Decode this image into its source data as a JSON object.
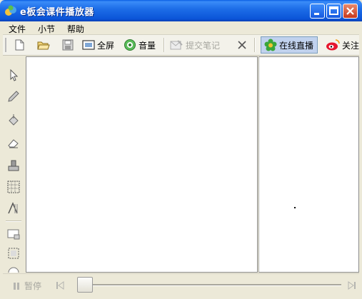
{
  "window": {
    "title": "e板会课件播放器",
    "controls": [
      "minimize",
      "maximize",
      "close"
    ]
  },
  "menu": {
    "items": [
      {
        "label": "文件"
      },
      {
        "label": "小节"
      },
      {
        "label": "帮助"
      }
    ]
  },
  "toolbar": {
    "fullscreen_label": "全屏",
    "volume_label": "音量",
    "submit_notes_label": "提交笔记",
    "live_label": "在线直播",
    "follow_label": "关注"
  },
  "left_tools": [
    "pointer-icon",
    "pen-icon",
    "fill-icon",
    "eraser-icon",
    "stamp-icon",
    "grid-icon",
    "text-icon",
    "screen-icon",
    "select-icon"
  ],
  "player": {
    "pause_label": "暂停",
    "progress": 0
  },
  "colors": {
    "titlebar": "#0b55d8",
    "window_bg": "#ece9d8",
    "live_highlight": "#c1d2ee"
  }
}
